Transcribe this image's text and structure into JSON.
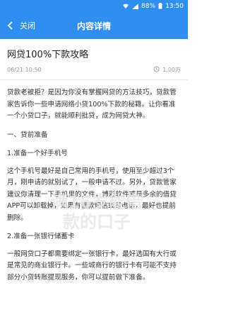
{
  "status_bar": {
    "battery": "88%",
    "time": "13:50",
    "icons": [
      "wifi-icon",
      "signal-icon",
      "battery-icon"
    ]
  },
  "app_bar": {
    "back_label": "关闭",
    "title": "内容详情"
  },
  "article": {
    "title": "网贷100%下款攻略",
    "date": "06/21 10:50",
    "views": "1.00万",
    "intro": "贷款老被拒？是因为你没有掌握网贷的方法技巧，贷款管家告诉你一些申请网络小贷100%下款的秘籍。让你看准一个小贷口子，就能顺利批贷，成为网贷大神。",
    "section1": "一、贷前准备",
    "sub1": "1.准备一个好手机号",
    "para1": "这个手机号最好是自己常用的手机号，使用至少超过3个月，刚申请的就别试了，一般申请不过。另外，贷款管家建议你清理一下手机里的文件，博彩软件或是多余的借贷APP可以卸载掉，如果有催款短信或是电话，最好也提前删除。",
    "sub2": "2.准备一张银行储蓄卡",
    "para2": "一般网贷口子都需要绑定一张银行卡，最好选国有大行或是常见的商业银行卡。一些城商行的银行卡有可能不支持部分小贷转账提现服务，你可以提前做下准备。"
  },
  "watermark": "满16岁能借款的口子",
  "colors": {
    "primary": "#2f8ff0",
    "text": "#333333",
    "meta": "#999999"
  }
}
